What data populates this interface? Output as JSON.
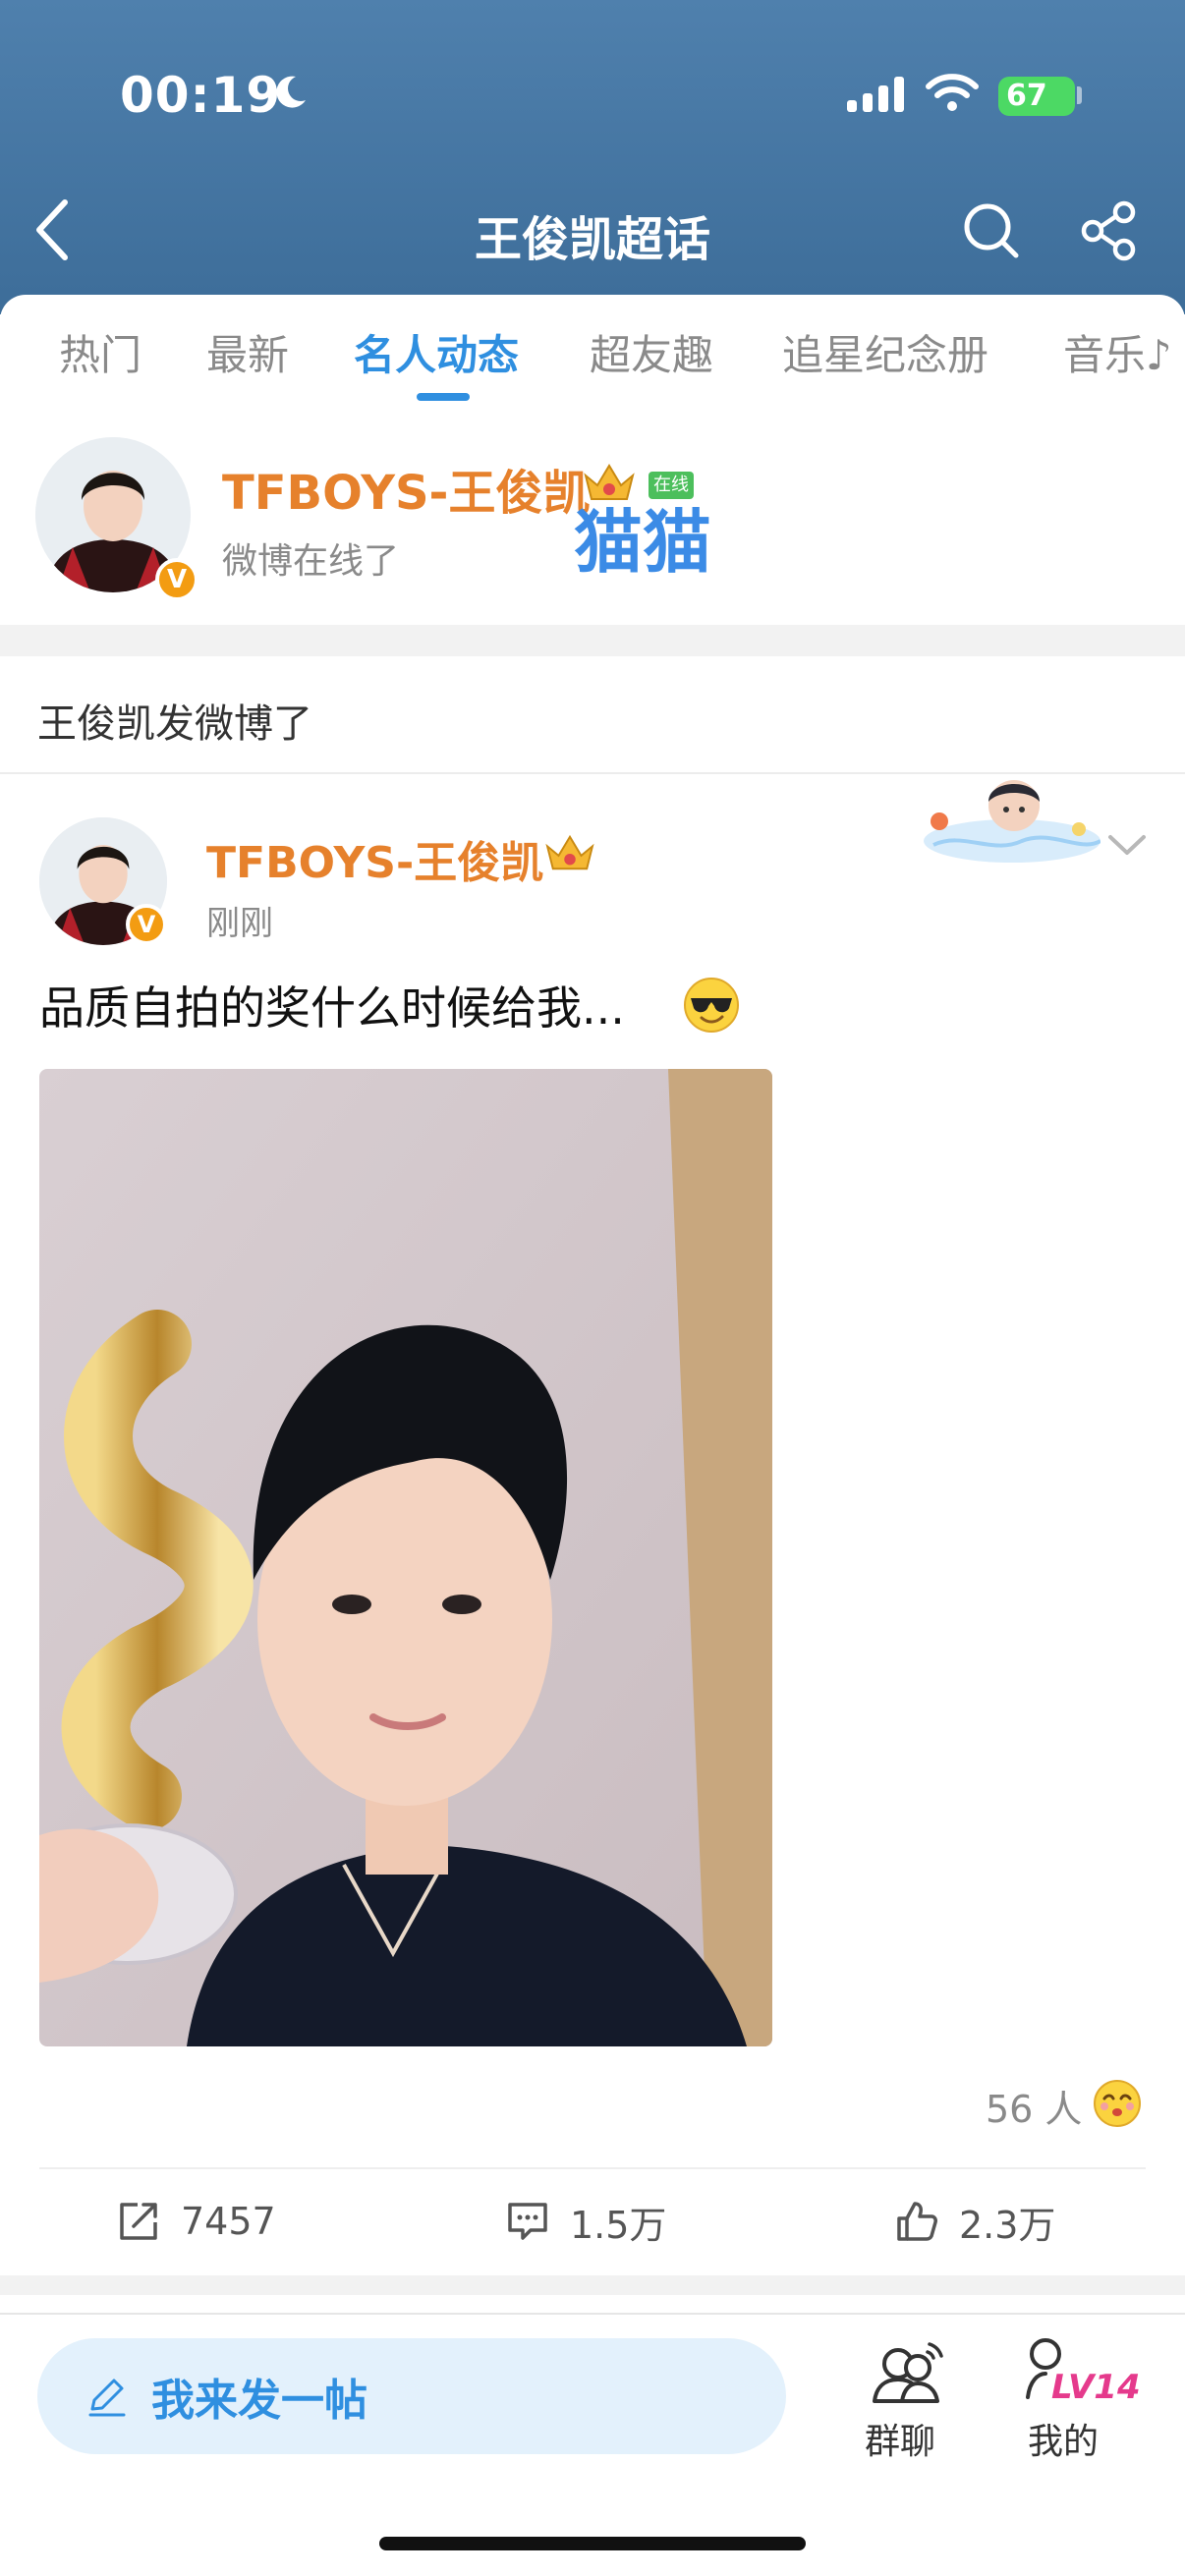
{
  "status_bar": {
    "time": "00:19",
    "battery": "67"
  },
  "header": {
    "title": "王俊凯超话"
  },
  "tabs": [
    {
      "label": "热门"
    },
    {
      "label": "最新"
    },
    {
      "label": "名人动态"
    },
    {
      "label": "超友趣"
    },
    {
      "label": "追星纪念册"
    },
    {
      "label": "音乐♪"
    }
  ],
  "celebrity": {
    "name": "TFBOYS-王俊凯",
    "online_tag": "在线",
    "nickname_overlay": "猫猫",
    "status": "微博在线了",
    "verified_mark": "V"
  },
  "section": {
    "title": "王俊凯发微博了"
  },
  "post": {
    "author": "TFBOYS-王俊凯",
    "time": "刚刚",
    "text": "品质自拍的奖什么时候给我...",
    "likers": "56 人",
    "reposts": "7457",
    "comments": "1.5万",
    "likes": "2.3万"
  },
  "bottom_bar": {
    "compose_label": "我来发一帖",
    "group_chat_label": "群聊",
    "me_label": "我的",
    "level_badge": "LV14"
  },
  "colors": {
    "header_blue": "#4a7aa6",
    "accent_blue": "#2f8fe0",
    "name_orange": "#e6812c",
    "level_pink": "#e53a8c"
  }
}
